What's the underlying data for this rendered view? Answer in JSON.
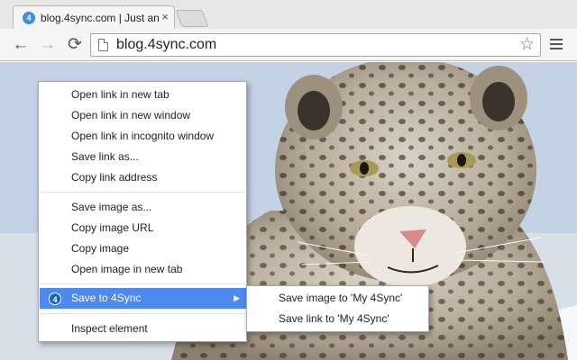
{
  "tab": {
    "favicon": "4",
    "title": "blog.4sync.com | Just an",
    "close": "×"
  },
  "toolbar": {
    "back": "←",
    "forward": "→",
    "reload": "⟳",
    "url": "blog.4sync.com",
    "star": "☆"
  },
  "context_menu": {
    "items": [
      "Open link in new tab",
      "Open link in new window",
      "Open link in incognito window",
      "Save link as...",
      "Copy link address",
      "Save image as...",
      "Copy image URL",
      "Copy image",
      "Open image in new tab",
      "Save to 4Sync",
      "Inspect element"
    ],
    "save_to_4sync_icon": "4",
    "submenu_arrow": "▶"
  },
  "submenu": {
    "items": [
      "Save image to 'My 4Sync'",
      "Save link to 'My 4Sync'"
    ]
  },
  "colors": {
    "highlight": "#4c8af0",
    "brand": "#1b5fc8"
  }
}
